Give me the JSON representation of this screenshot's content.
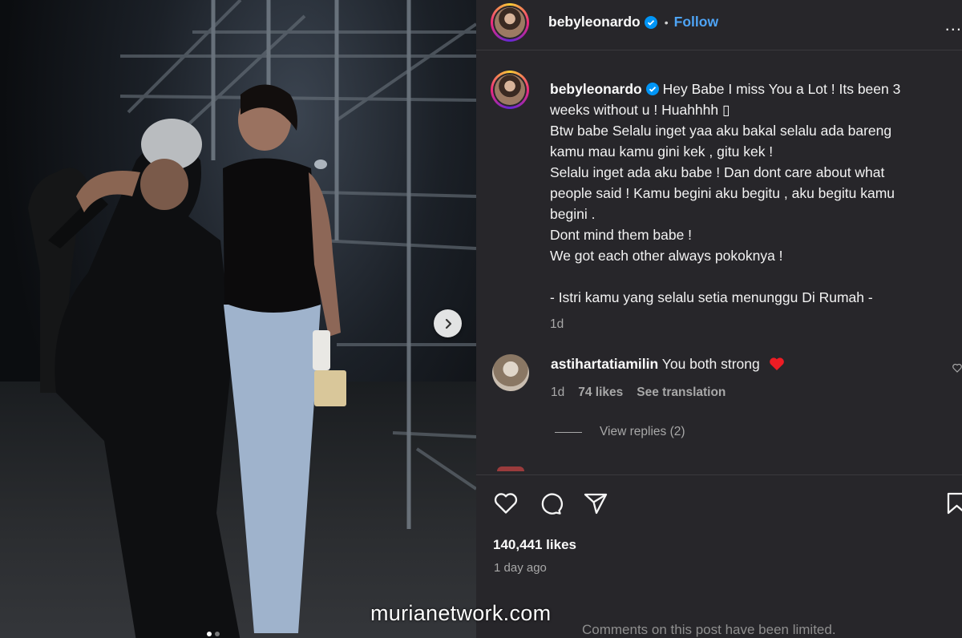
{
  "post": {
    "username": "bebyleonardo",
    "follow_label": "Follow",
    "more_label": "...",
    "caption_lines": [
      "Hey Babe I miss You a Lot ! Its been 3",
      "weeks without u ! Huahhhh ▯",
      "Btw babe Selalu inget yaa aku bakal selalu ada bareng",
      "kamu mau kamu gini kek , gitu kek !",
      "Selalu inget ada aku babe ! Dan dont care about what",
      "people said ! Kamu begini aku begitu , aku begitu kamu",
      "begini .",
      "Dont mind them babe !",
      "We got each other always pokoknya !",
      "- Istri kamu yang selalu setia menunggu Di Rumah -"
    ],
    "caption_age": "1d",
    "likes": "140,441 likes",
    "date": "1 day ago",
    "comments_limited": "Comments on this post have been limited."
  },
  "comment": {
    "username": "astihartatiamilin",
    "text": "You both strong",
    "age": "1d",
    "likes": "74 likes",
    "translate": "See translation",
    "view_replies": "View replies (2)"
  },
  "watermark": "murianetwork.com",
  "colors": {
    "panel_bg": "#27262a",
    "follow_blue": "#4ea4f6",
    "verified_blue": "#0095f6",
    "heart_red": "#ed1c24",
    "muted_text": "#a8a8a8"
  },
  "icons": [
    "verified-badge-icon",
    "heart-icon",
    "comment-icon",
    "share-icon",
    "bookmark-icon",
    "chevron-right-icon",
    "more-icon"
  ]
}
